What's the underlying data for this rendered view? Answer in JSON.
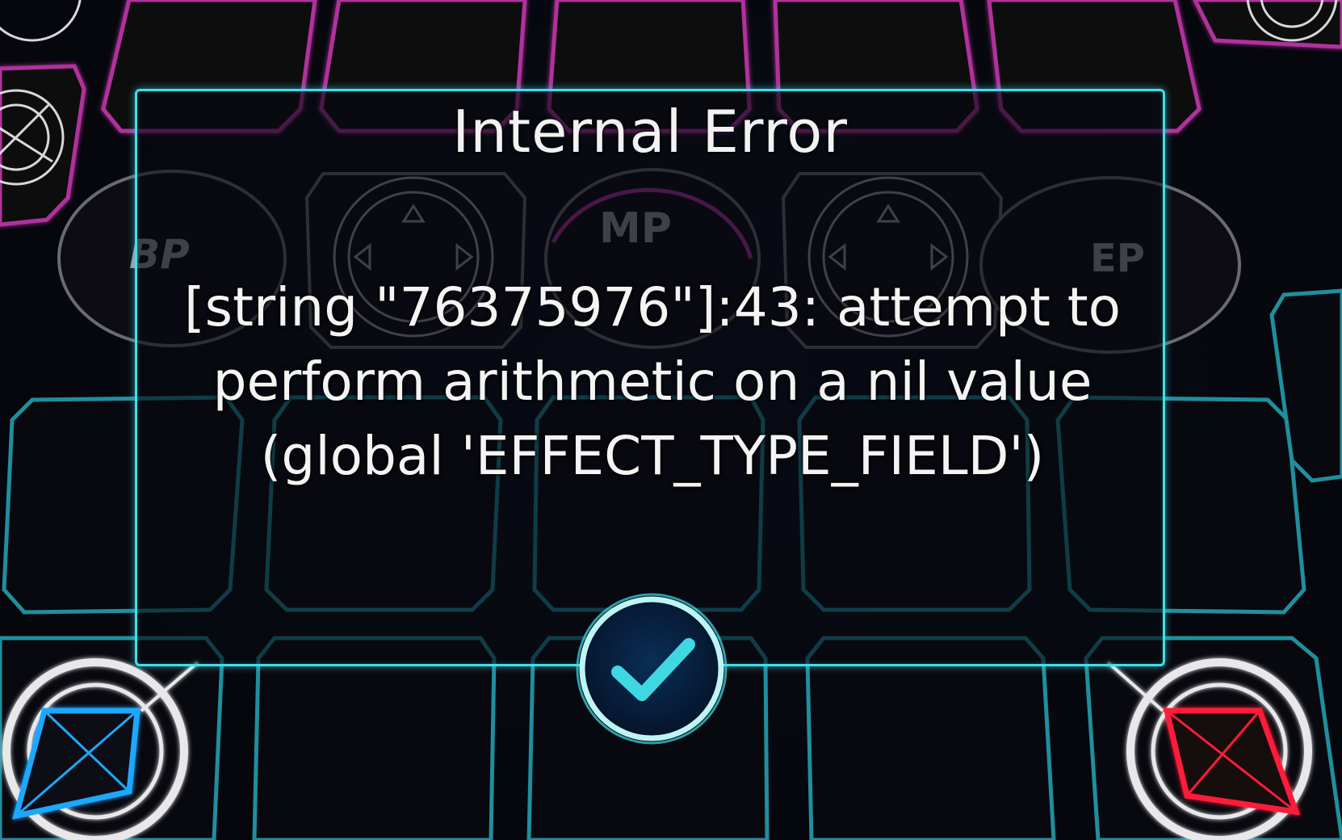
{
  "board": {
    "slot_left_label": "BP",
    "slot_center_label": "MP",
    "slot_right_label": "EP",
    "colors": {
      "top_row": "#b0309c",
      "middle_rows": "#1f8f9c",
      "player_marker": "#1fa8ff",
      "opponent_marker": "#ff1f3a"
    }
  },
  "dialog": {
    "title": "Internal Error",
    "message": "[string \"76375976\"]:43: attempt to perform arithmetic on a nil value (global 'EFFECT_TYPE_FIELD')",
    "border_color": "#3fe0ea",
    "confirm_icon": "checkmark-icon"
  }
}
